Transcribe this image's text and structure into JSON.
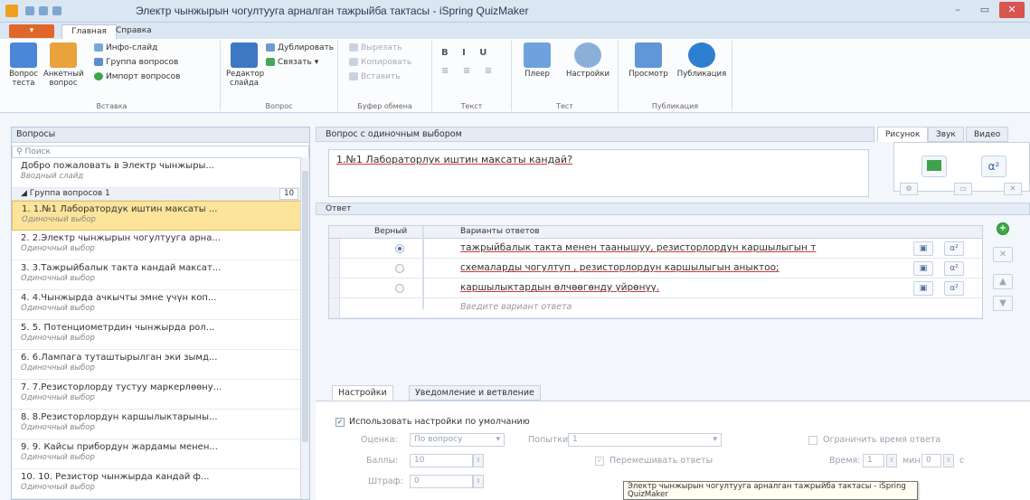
{
  "window": {
    "title": "Электр чынжырын чогултууга арналган тажрыйба тактасы - iSpring QuizMaker",
    "minimize": "–",
    "maximize": "▭",
    "close": "✕"
  },
  "ribbon": {
    "tabs": [
      "Главная",
      "Справка"
    ],
    "insert": {
      "quiz_test": "Вопрос\nтеста",
      "survey_question": "Анкетный\nвопрос",
      "info_slide": "Инфо-слайд",
      "question_group": "Группа вопросов",
      "import_questions": "Импорт вопросов",
      "label": "Вставка"
    },
    "question": {
      "slide_editor": "Редактор\nслайда",
      "duplicate": "Дублировать",
      "link": "Связать",
      "label": "Вопрос"
    },
    "clipboard": {
      "cut": "Вырезать",
      "copy": "Копировать",
      "paste": "Вставить",
      "label": "Буфер обмена"
    },
    "text": {
      "label": "Текст"
    },
    "test": {
      "player": "Плеер",
      "settings": "Настройки",
      "label": "Тест"
    },
    "publish": {
      "preview": "Просмотр",
      "publish": "Публикация",
      "label": "Публикация"
    }
  },
  "left": {
    "header": "Вопросы",
    "search_placeholder": "Поиск",
    "welcome": {
      "title": "Добро пожаловать в Электр чынжыры...",
      "sub": "Вводный слайд"
    },
    "group": {
      "name": "Группа вопросов 1",
      "count": "10"
    },
    "items": [
      {
        "title": "1. 1.№1 Лаборатордук иштин максаты ...",
        "sub": "Одиночный выбор"
      },
      {
        "title": "2. 2.Электр чынжырын чогултууга арна...",
        "sub": "Одиночный выбор"
      },
      {
        "title": "3. 3.Тажрыйбалык такта кандай максат...",
        "sub": "Одиночный выбор"
      },
      {
        "title": "4. 4.Чынжырда ачкычты эмне үчүн коп...",
        "sub": "Одиночный выбор"
      },
      {
        "title": "5. 5. Потенциометрдин чынжырда  рол...",
        "sub": "Одиночный выбор"
      },
      {
        "title": "6. 6.Лампага туташтырылган эки зымд...",
        "sub": "Одиночный выбор"
      },
      {
        "title": "7. 7.Резисторлорду тустуу маркерлөөну...",
        "sub": "Одиночный выбор"
      },
      {
        "title": "8. 8.Резисторлордун каршылыктарыны...",
        "sub": "Одиночный выбор"
      },
      {
        "title": "9. 9.  Кайсы прибордун жардамы менен...",
        "sub": "Одиночный выбор"
      },
      {
        "title": "10. 10.  Резистор чынжырда кандай ф...",
        "sub": "Одиночный выбор"
      }
    ]
  },
  "question": {
    "header": "Вопрос с одиночным выбором",
    "text": "1.№1 Лабораторлук иштин максаты кандай?"
  },
  "media": {
    "tabs": [
      "Рисунок",
      "Звук",
      "Видео"
    ],
    "formula": "α²"
  },
  "answers": {
    "header": "Ответ",
    "col_correct": "Верный",
    "col_options": "Варианты ответов",
    "rows": [
      {
        "text": "тажрыйбалык такта менен таанышуу, резисторлордун каршылыгын т",
        "correct": true
      },
      {
        "text": "схемаларды чогултуп , резисторлордун каршылыгын аныктоо;",
        "correct": false
      },
      {
        "text": "каршылыктардын  өлчөөгөнду үйрөнүү.",
        "correct": false
      }
    ],
    "placeholder": "Введите вариант ответа",
    "formula_icon": "α²"
  },
  "settings": {
    "tabs": [
      "Настройки",
      "Уведомление и ветвление"
    ],
    "use_default": "Использовать настройки по умолчанию",
    "score_label": "Оценка:",
    "score_value": "По вопросу",
    "attempts_label": "Попытки:",
    "attempts_value": "1",
    "limit_time": "Ограничить время ответа",
    "points_label": "Баллы:",
    "points_value": "10",
    "shuffle": "Перемешивать ответы",
    "time_label": "Время:",
    "time_min": "1",
    "min_label": "мин",
    "time_sec": "0",
    "sec_label": "с",
    "penalty_label": "Штраф:",
    "penalty_value": "0"
  },
  "tooltip": "Электр чынжырын чогултууга арналган тажрыйба тактасы - iSpring QuizMaker"
}
